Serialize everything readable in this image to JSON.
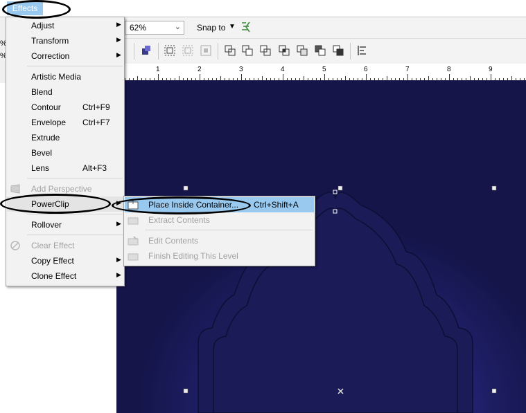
{
  "menubar": {
    "effects_label": "Effects"
  },
  "toolbar": {
    "zoom_value": "62%",
    "snap_label": "Snap to",
    "left_pct_1": "%",
    "left_pct_2": "%"
  },
  "ruler": {
    "numbers": [
      "1",
      "2",
      "3",
      "4",
      "5",
      "6",
      "7",
      "8",
      "9"
    ]
  },
  "effects_menu": {
    "items": [
      {
        "label": "Adjust",
        "shortcut": ""
      },
      {
        "label": "Transform",
        "shortcut": ""
      },
      {
        "label": "Correction",
        "shortcut": ""
      },
      {
        "label": "Artistic Media",
        "shortcut": ""
      },
      {
        "label": "Blend",
        "shortcut": ""
      },
      {
        "label": "Contour",
        "shortcut": "Ctrl+F9"
      },
      {
        "label": "Envelope",
        "shortcut": "Ctrl+F7"
      },
      {
        "label": "Extrude",
        "shortcut": ""
      },
      {
        "label": "Bevel",
        "shortcut": ""
      },
      {
        "label": "Lens",
        "shortcut": "Alt+F3"
      },
      {
        "label": "Add Perspective",
        "shortcut": ""
      },
      {
        "label": "PowerClip",
        "shortcut": ""
      },
      {
        "label": "Rollover",
        "shortcut": ""
      },
      {
        "label": "Clear Effect",
        "shortcut": ""
      },
      {
        "label": "Copy Effect",
        "shortcut": ""
      },
      {
        "label": "Clone Effect",
        "shortcut": ""
      }
    ]
  },
  "powerclip_menu": {
    "items": [
      {
        "label": "Place Inside Container...",
        "shortcut": "Ctrl+Shift+A"
      },
      {
        "label": "Extract Contents",
        "shortcut": ""
      },
      {
        "label": "Edit Contents",
        "shortcut": ""
      },
      {
        "label": "Finish Editing This Level",
        "shortcut": ""
      }
    ]
  },
  "colors": {
    "highlight": "#99c9ef",
    "canvas_dark": "#15154a",
    "canvas_glow": "#4448c8"
  }
}
